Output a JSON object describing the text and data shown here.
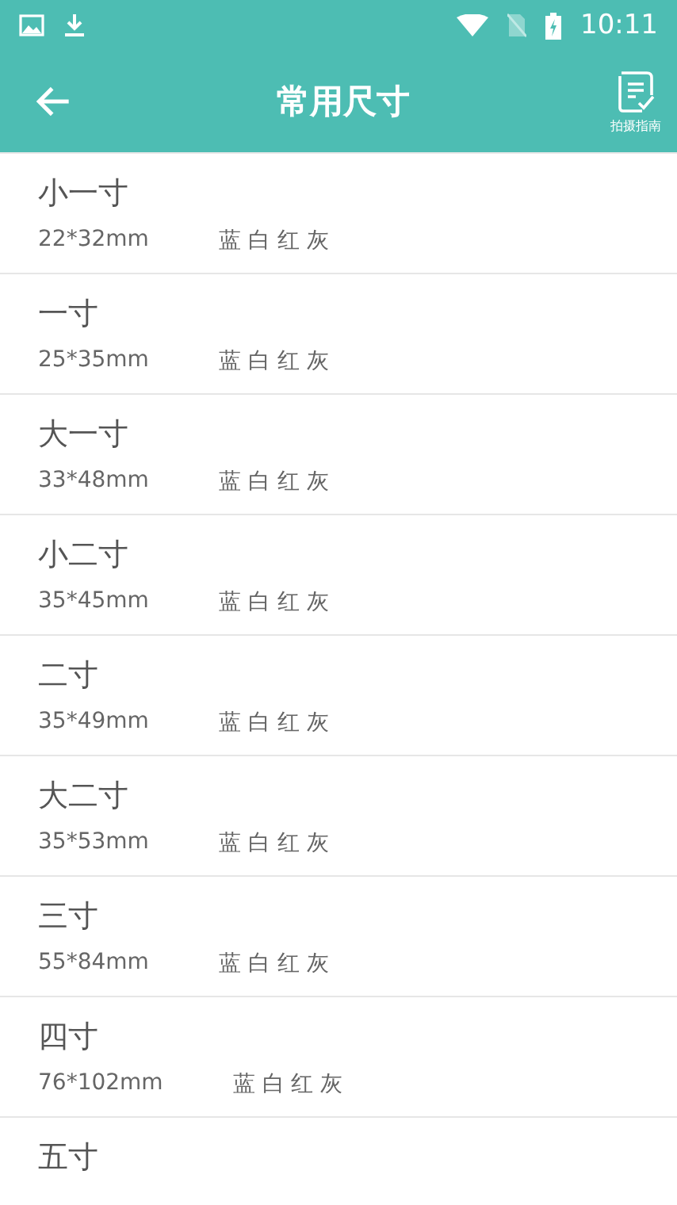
{
  "status_bar": {
    "time": "10:11"
  },
  "toolbar": {
    "title": "常用尺寸",
    "action_label": "拍摄指南"
  },
  "sizes": [
    {
      "name": "小一寸",
      "dimensions": "22*32mm",
      "colors": "蓝 白 红 灰"
    },
    {
      "name": "一寸",
      "dimensions": "25*35mm",
      "colors": "蓝 白 红 灰"
    },
    {
      "name": "大一寸",
      "dimensions": "33*48mm",
      "colors": "蓝 白 红 灰"
    },
    {
      "name": "小二寸",
      "dimensions": "35*45mm",
      "colors": "蓝 白 红 灰"
    },
    {
      "name": "二寸",
      "dimensions": "35*49mm",
      "colors": "蓝 白 红 灰"
    },
    {
      "name": "大二寸",
      "dimensions": "35*53mm",
      "colors": "蓝 白 红 灰"
    },
    {
      "name": "三寸",
      "dimensions": "55*84mm",
      "colors": "蓝 白 红 灰"
    },
    {
      "name": "四寸",
      "dimensions": "76*102mm",
      "colors": "蓝 白 红 灰"
    },
    {
      "name": "五寸"
    }
  ]
}
